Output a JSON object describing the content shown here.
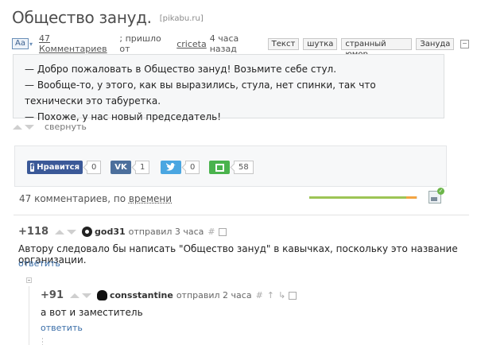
{
  "post": {
    "title": "Общество зануд.",
    "domain": "[pikabu.ru]",
    "font_size_button": "Aa",
    "comments_link": "47 Комментариев",
    "came_from_text": "; пришло от",
    "author": "criceta",
    "time_ago": "4 часа назад",
    "tags": [
      "Текст",
      "шутка",
      "странный юмор",
      "Зануда"
    ],
    "story_lines": [
      "— Добро пожаловать в Общество зануд! Возьмите себе стул.",
      "— Вообще-то, у этого, как вы выразились, стула, нет спинки, так что технически это табуретка.",
      "— Похоже, у нас новый председатель!"
    ],
    "collapse_label": "свернуть"
  },
  "share": {
    "facebook_label": "Нравится",
    "facebook_count": "0",
    "vk_label": "VK",
    "vk_count": "1",
    "twitter_count": "0",
    "save_count": "58"
  },
  "comments_header": {
    "count_text": "47 комментариев, по",
    "sort_label": "времени",
    "progress_green": 0.9,
    "progress_orange": 0.09
  },
  "comments": [
    {
      "rating": "+118",
      "user": "god31",
      "sent_text": "отправил 3 часа",
      "text": "Автору следовало бы написать \"Общество зануд\" в кавычках, поскольку это название организации.",
      "reply": "ответить"
    },
    {
      "rating": "+91",
      "user": "consstantine",
      "sent_text": "отправил 2 часа",
      "text": "а вот и заместитель",
      "reply": "ответить"
    }
  ],
  "colors": {
    "link": "#3a6ea8",
    "facebook": "#3b5998",
    "vk": "#4c6f9c",
    "twitter": "#4aa6e1",
    "save": "#4ab34d",
    "progress_green": "#9dc555",
    "progress_orange": "#f3a442"
  }
}
